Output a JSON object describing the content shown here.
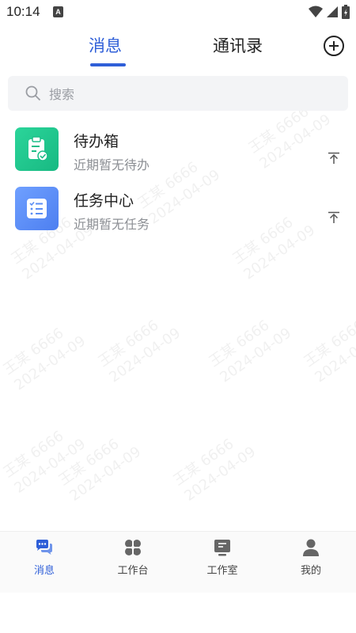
{
  "status_bar": {
    "time": "10:14",
    "notification_badge": "A"
  },
  "top_tabs": [
    {
      "label": "消息",
      "active": true
    },
    {
      "label": "通讯录",
      "active": false
    }
  ],
  "search": {
    "placeholder": "搜索"
  },
  "watermark": {
    "name": "王某 6666",
    "date": "2024-04-09"
  },
  "messages": [
    {
      "title": "待办箱",
      "subtitle": "近期暂无待办",
      "icon": "clipboard-check-icon",
      "color": "#22c58e"
    },
    {
      "title": "任务中心",
      "subtitle": "近期暂无任务",
      "icon": "task-list-icon",
      "color": "#5b8ef5"
    }
  ],
  "bottom_nav": [
    {
      "label": "消息",
      "icon": "chat-bubbles-icon",
      "active": true
    },
    {
      "label": "工作台",
      "icon": "four-petals-icon",
      "active": false
    },
    {
      "label": "工作室",
      "icon": "monitor-icon",
      "active": false
    },
    {
      "label": "我的",
      "icon": "person-icon",
      "active": false
    }
  ],
  "colors": {
    "accent": "#2f5fd8"
  }
}
